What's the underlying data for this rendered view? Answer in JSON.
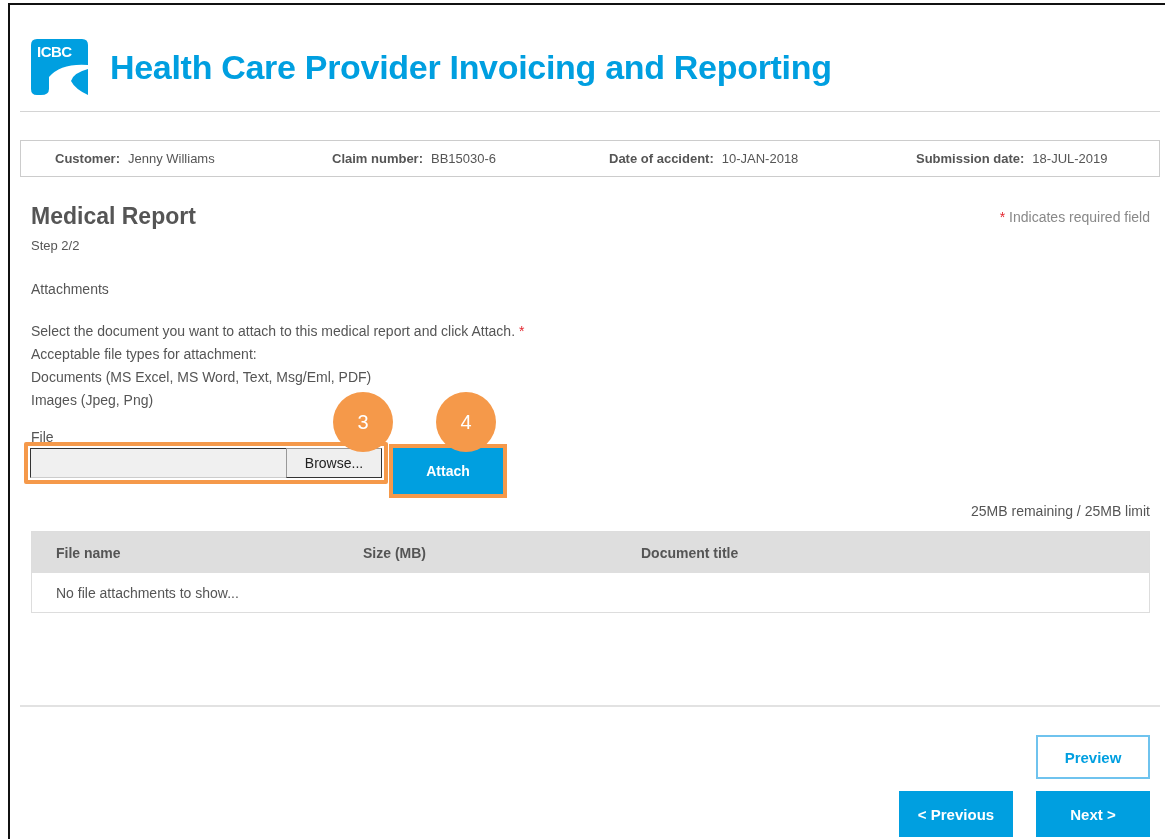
{
  "header": {
    "logo_text": "ICBC",
    "title": "Health Care Provider Invoicing and Reporting"
  },
  "info_bar": [
    {
      "label": "Customer:",
      "value": "Jenny Williams"
    },
    {
      "label": "Claim number:",
      "value": "BB15030-6"
    },
    {
      "label": "Date of accident:",
      "value": "10-JAN-2018"
    },
    {
      "label": "Submission date:",
      "value": "18-JUL-2019"
    }
  ],
  "page": {
    "title": "Medical Report",
    "step": "Step 2/2",
    "required_mark": "*",
    "required_note": "Indicates required field"
  },
  "attachments": {
    "section": "Attachments",
    "instruction": "Select the document you want to attach to this medical report and click Attach.",
    "instruction_mark": "*",
    "types": [
      "Acceptable file types for attachment:",
      "Documents (MS Excel, MS Word, Text, Msg/Eml, PDF)",
      "Images (Jpeg, Png)"
    ],
    "file_label": "File",
    "browse": "Browse...",
    "attach": "Attach",
    "callouts": [
      "3",
      "4"
    ],
    "quota": "25MB remaining / 25MB limit"
  },
  "table": {
    "columns": [
      "File name",
      "Size (MB)",
      "Document title"
    ],
    "empty": "No file attachments to show..."
  },
  "buttons": {
    "preview": "Preview",
    "previous": "< Previous",
    "next": "Next >"
  }
}
